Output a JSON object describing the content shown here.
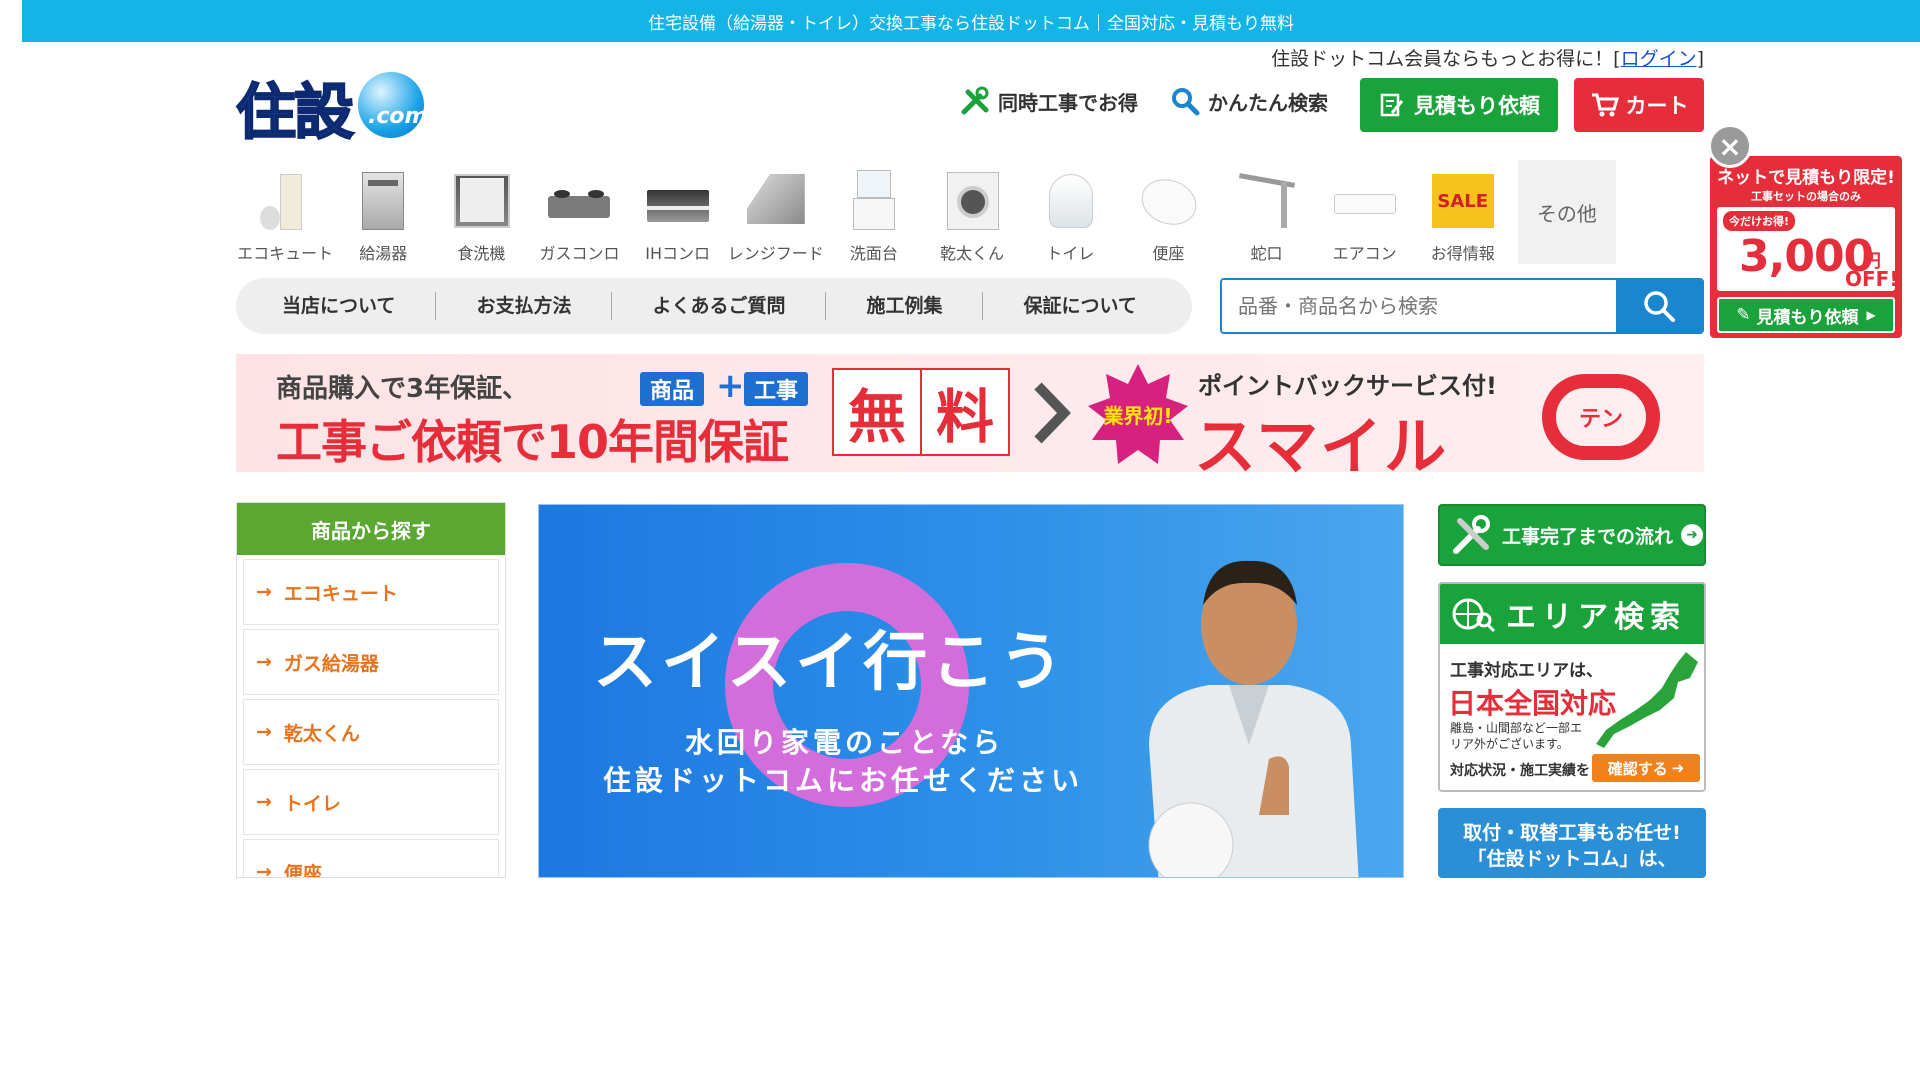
{
  "topbar": {
    "text": "住宅設備（給湯器・トイレ）交換工事なら住設ドットコム｜全国対応・見積もり無料"
  },
  "member": {
    "prefix": "住設ドットコム会員ならもっとお得に！[",
    "login": "ログイン",
    "suffix": "]"
  },
  "logo": {
    "main": "住設",
    "sub": ".com"
  },
  "header": {
    "simul_label": "同時工事でお得",
    "search_label": "かんたん検索",
    "estimate_label": "見積もり依頼",
    "cart_label": "カート"
  },
  "categories": [
    {
      "label": "エコキュート",
      "icon": "ecocute-icon"
    },
    {
      "label": "給湯器",
      "icon": "water-heater-icon"
    },
    {
      "label": "食洗機",
      "icon": "dishwasher-icon"
    },
    {
      "label": "ガスコンロ",
      "icon": "gas-stove-icon"
    },
    {
      "label": "IHコンロ",
      "icon": "ih-stove-icon"
    },
    {
      "label": "レンジフード",
      "icon": "range-hood-icon"
    },
    {
      "label": "洗面台",
      "icon": "washbasin-icon"
    },
    {
      "label": "乾太くん",
      "icon": "dryer-icon"
    },
    {
      "label": "トイレ",
      "icon": "toilet-icon"
    },
    {
      "label": "便座",
      "icon": "toilet-seat-icon"
    },
    {
      "label": "蛇口",
      "icon": "faucet-icon"
    },
    {
      "label": "エアコン",
      "icon": "aircon-icon"
    },
    {
      "label": "お得情報",
      "icon": "sale-icon",
      "badge": "SALE"
    }
  ],
  "other_category": "その他",
  "gnav": [
    "当店について",
    "お支払方法",
    "よくあるご質問",
    "施工例集",
    "保証について"
  ],
  "search": {
    "placeholder": "品番・商品名から検索"
  },
  "banner": {
    "line1": "商品購入で3年保証、",
    "line2": "工事ご依頼で10年間保証",
    "tag1": "商品",
    "plus": "+",
    "tag2": "工事",
    "free1": "無",
    "free2": "料",
    "star": "業界初!",
    "pointback": "ポイントバックサービス付!",
    "smile": "スマイル",
    "ten": "テン"
  },
  "sidebar": {
    "header": "商品から探す",
    "items": [
      "エコキュート",
      "ガス給湯器",
      "乾太くん",
      "トイレ",
      "便座"
    ]
  },
  "hero": {
    "title": "スイスイ行こう",
    "sub1": "水回り家電のことなら",
    "sub2": "住設ドットコムにお任せください"
  },
  "right": {
    "flow": "工事完了までの流れ",
    "area_title": "エリア検索",
    "area_a": "工事対応エリアは、",
    "area_b": "日本全国対応",
    "area_c": "離島・山間部など一部エリア外がございます。",
    "area_d": "対応状況・施工実績を",
    "area_e": "確認する",
    "r3_l1": "取付・取替工事もお任せ!",
    "r3_l2": "「住設ドットコム」は、"
  },
  "promo": {
    "p1": "ネットで見積もり限定!",
    "p2": "工事セットの場合のみ",
    "badge": "今だけお得!",
    "amount": "3,000",
    "yen": "円",
    "off": "OFF!",
    "btn": "見積もり依頼"
  },
  "colors": {
    "topbar": "#14b4e7",
    "green": "#1aa33b",
    "red": "#e62e3b",
    "blue": "#1a86d0",
    "orange": "#e8731c"
  }
}
